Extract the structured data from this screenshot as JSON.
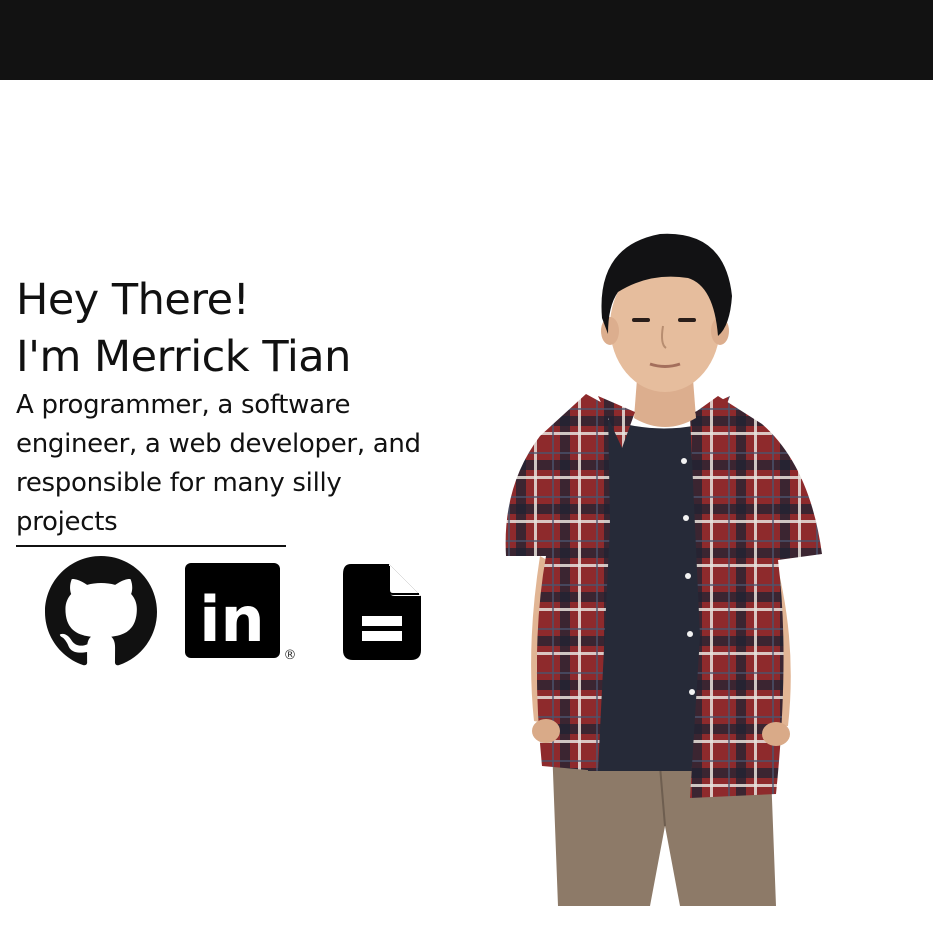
{
  "hero": {
    "greeting_line1": "Hey There!",
    "greeting_line2": "I'm Merrick Tian",
    "tagline_line1": "A programmer, a software",
    "tagline_line2": "engineer, a web developer, and",
    "tagline_line3": "responsible for many silly",
    "tagline_line4": "projects"
  },
  "social": [
    {
      "icon": "github-icon"
    },
    {
      "icon": "linkedin-icon",
      "mark": "in",
      "registered": "®"
    },
    {
      "icon": "resume-document-icon"
    }
  ],
  "colors": {
    "topbar": "#121212",
    "text": "#111111",
    "background": "#ffffff",
    "shirt_red": "#8e2a2c",
    "tshirt": "#262a38",
    "pants": "#8d7a68"
  }
}
